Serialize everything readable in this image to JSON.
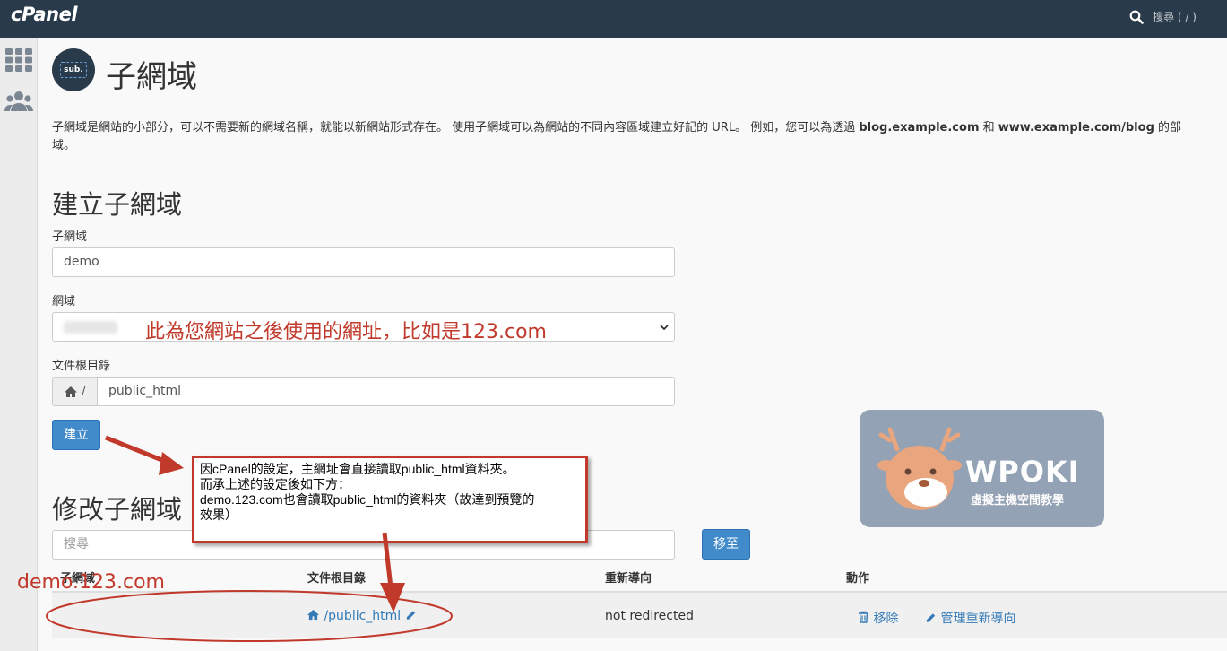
{
  "topbar": {
    "logo": "cPanel",
    "search_placeholder": "搜尋 ( / )"
  },
  "page": {
    "title": "子網域",
    "description_prefix": "子網域是網站的小部分，可以不需要新的網域名稱，就能以新網站形式存在。 使用子網域可以為網站的不同內容區域建立好記的 URL。 例如，您可以為透過 ",
    "description_example1": "blog.example.com",
    "description_and": " 和 ",
    "description_example2": "www.example.com/blog",
    "description_suffix": " 的部",
    "description_line2": "域。"
  },
  "create": {
    "heading": "建立子網域",
    "subdomain_label": "子網域",
    "subdomain_value": "demo",
    "domain_label": "網域",
    "docroot_label": "文件根目錄",
    "docroot_prefix": "/",
    "docroot_value": "public_html",
    "create_button": "建立"
  },
  "modify": {
    "heading": "修改子網域",
    "search_placeholder": "搜尋",
    "go_button": "移至",
    "columns": [
      "子網域",
      "文件根目錄",
      "重新導向",
      "動作"
    ],
    "row": {
      "subdomain": "demo.123.com",
      "docroot": "/public_html",
      "redirect": "not redirected",
      "remove": "移除",
      "manage_redirect": "管理重新導向"
    }
  },
  "annotations": {
    "domain_note": "此為您網站之後使用的網址，比如是123.com",
    "callout_line1": "因cPanel的設定，主網址會直接讀取public_html資料夾。",
    "callout_line2": "而承上述的設定後如下方：",
    "callout_line3": "demo.123.com也會讀取public_html的資料夾（故達到預覽的",
    "callout_line4": "效果）"
  },
  "watermark": {
    "brand": "WPOKI",
    "tagline": "虛擬主機空間教學"
  },
  "colors": {
    "topbar": "#293a4a",
    "primary": "#428bca",
    "link": "#337ab7",
    "annotation": "#c0392b"
  }
}
